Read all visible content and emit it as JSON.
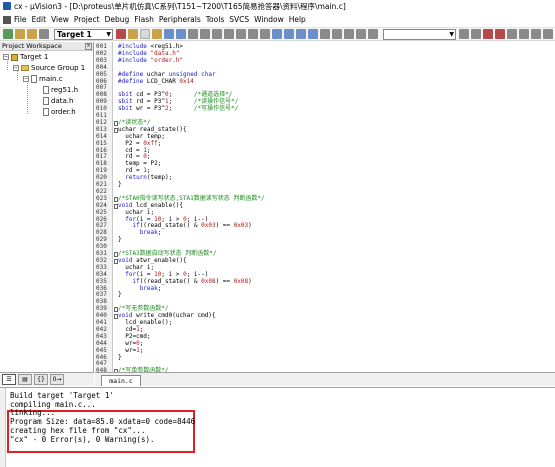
{
  "window": {
    "title": "cx - µVision3 - [D:\\proteus\\单片机仿真\\C系列\\T151~T200\\T165简易抢答器\\资料\\程序\\main.c]"
  },
  "menu": [
    "File",
    "Edit",
    "View",
    "Project",
    "Debug",
    "Flash",
    "Peripherals",
    "Tools",
    "SVCS",
    "Window",
    "Help"
  ],
  "toolbar": {
    "target_value": "Target 1",
    "find_value": ""
  },
  "workspace": {
    "title": "Project Workspace",
    "tree": [
      {
        "label": "Target 1",
        "type": "target",
        "expander": "−"
      },
      {
        "label": "Source Group 1",
        "type": "group",
        "expander": "−"
      },
      {
        "label": "main.c",
        "type": "file",
        "expander": "−"
      },
      {
        "label": "reg51.h",
        "type": "file",
        "expander": ""
      },
      {
        "label": "data.h",
        "type": "file",
        "expander": ""
      },
      {
        "label": "order.h",
        "type": "file",
        "expander": ""
      }
    ],
    "tabs": [
      {
        "icon": "files-tab-icon",
        "glyph": "☰"
      },
      {
        "icon": "books-tab-icon",
        "glyph": "▤"
      },
      {
        "icon": "functions-tab-icon",
        "glyph": "{}"
      },
      {
        "icon": "templates-tab-icon",
        "glyph": "0→"
      }
    ]
  },
  "editor": {
    "lines": [
      {
        "n": "001",
        "t": "#include <reg51.h>",
        "c": "pp",
        "f": ""
      },
      {
        "n": "002",
        "t": "#include \"data.h\"",
        "c": "pp",
        "f": ""
      },
      {
        "n": "003",
        "t": "#include \"order.h\"",
        "c": "pp",
        "f": ""
      },
      {
        "n": "004",
        "t": "",
        "c": "",
        "f": ""
      },
      {
        "n": "005",
        "t": "#define uchar unsigned char",
        "c": "pp",
        "f": ""
      },
      {
        "n": "006",
        "t": "#define LCD_CHAR 0x14",
        "c": "pp",
        "f": ""
      },
      {
        "n": "007",
        "t": "",
        "c": "",
        "f": ""
      },
      {
        "n": "008",
        "t": "sbit cd = P3^0;      /*通道选择*/",
        "c": "mix",
        "f": ""
      },
      {
        "n": "009",
        "t": "sbit rd = P3^1;      /*读操作信号*/",
        "c": "mix",
        "f": ""
      },
      {
        "n": "010",
        "t": "sbit wr = P3^2;      /*写操作信号*/",
        "c": "mix",
        "f": ""
      },
      {
        "n": "011",
        "t": "",
        "c": "",
        "f": ""
      },
      {
        "n": "012",
        "t": "/*读状态*/",
        "c": "cm",
        "f": "box"
      },
      {
        "n": "013",
        "t": "uchar read_state(){",
        "c": "",
        "f": "box"
      },
      {
        "n": "014",
        "t": "  uchar temp;",
        "c": "",
        "f": ""
      },
      {
        "n": "015",
        "t": "  P2 = 0xff;",
        "c": "",
        "f": ""
      },
      {
        "n": "016",
        "t": "  cd = 1;",
        "c": "",
        "f": ""
      },
      {
        "n": "017",
        "t": "  rd = 0;",
        "c": "",
        "f": ""
      },
      {
        "n": "018",
        "t": "  temp = P2;",
        "c": "",
        "f": ""
      },
      {
        "n": "019",
        "t": "  rd = 1;",
        "c": "",
        "f": ""
      },
      {
        "n": "020",
        "t": "  return(temp);",
        "c": "",
        "f": ""
      },
      {
        "n": "021",
        "t": "}",
        "c": "",
        "f": ""
      },
      {
        "n": "022",
        "t": "",
        "c": "",
        "f": ""
      },
      {
        "n": "023",
        "t": "/*STA0指令读写状态,STA1数据读写状态 判断函数*/",
        "c": "cm",
        "f": "box"
      },
      {
        "n": "024",
        "t": "void lcd_enable(){",
        "c": "",
        "f": "box"
      },
      {
        "n": "025",
        "t": "  uchar i;",
        "c": "",
        "f": ""
      },
      {
        "n": "026",
        "t": "  for(i = 10; i > 0; i--)",
        "c": "",
        "f": ""
      },
      {
        "n": "027",
        "t": "    if((read_state() & 0x03) == 0x03)",
        "c": "",
        "f": ""
      },
      {
        "n": "028",
        "t": "      break;",
        "c": "",
        "f": ""
      },
      {
        "n": "029",
        "t": "}",
        "c": "",
        "f": ""
      },
      {
        "n": "030",
        "t": "",
        "c": "",
        "f": ""
      },
      {
        "n": "031",
        "t": "/*STA3数据自动写状态 判断函数*/",
        "c": "cm",
        "f": "box"
      },
      {
        "n": "032",
        "t": "void atwr_enable(){",
        "c": "",
        "f": "box"
      },
      {
        "n": "033",
        "t": "  uchar i;",
        "c": "",
        "f": ""
      },
      {
        "n": "034",
        "t": "  for(i = 10; i > 0; i--)",
        "c": "",
        "f": ""
      },
      {
        "n": "035",
        "t": "    if((read_state() & 0x08) == 0x08)",
        "c": "",
        "f": ""
      },
      {
        "n": "036",
        "t": "      break;",
        "c": "",
        "f": ""
      },
      {
        "n": "037",
        "t": "}",
        "c": "",
        "f": ""
      },
      {
        "n": "038",
        "t": "",
        "c": "",
        "f": ""
      },
      {
        "n": "039",
        "t": "/*写无参数函数*/",
        "c": "cm",
        "f": "box"
      },
      {
        "n": "040",
        "t": "void write_cmd0(uchar cmd){",
        "c": "",
        "f": "box"
      },
      {
        "n": "041",
        "t": "  lcd_enable();",
        "c": "",
        "f": ""
      },
      {
        "n": "042",
        "t": "  cd=1;",
        "c": "",
        "f": ""
      },
      {
        "n": "043",
        "t": "  P2=cmd;",
        "c": "",
        "f": ""
      },
      {
        "n": "044",
        "t": "  wr=0;",
        "c": "",
        "f": ""
      },
      {
        "n": "045",
        "t": "  wr=1;",
        "c": "",
        "f": ""
      },
      {
        "n": "046",
        "t": "}",
        "c": "",
        "f": ""
      },
      {
        "n": "047",
        "t": "",
        "c": "",
        "f": ""
      },
      {
        "n": "048",
        "t": "/*写单参数函数*/",
        "c": "cm",
        "f": "box"
      },
      {
        "n": "049",
        "t": "",
        "c": "",
        "f": ""
      }
    ]
  },
  "file_tab": "main.c",
  "output": {
    "lines": [
      "Build target 'Target 1'",
      "compiling main.c...",
      "linking...",
      "Program Size: data=85.0 xdata=0 code=8446",
      "creating hex file from \"cx\"...",
      "\"cx\" - 0 Error(s), 0 Warning(s)."
    ],
    "highlight_color": "#e02020"
  },
  "colors": {
    "keyword": "#1a1ac8",
    "comment": "#1d8a1d",
    "literal": "#b01616"
  }
}
